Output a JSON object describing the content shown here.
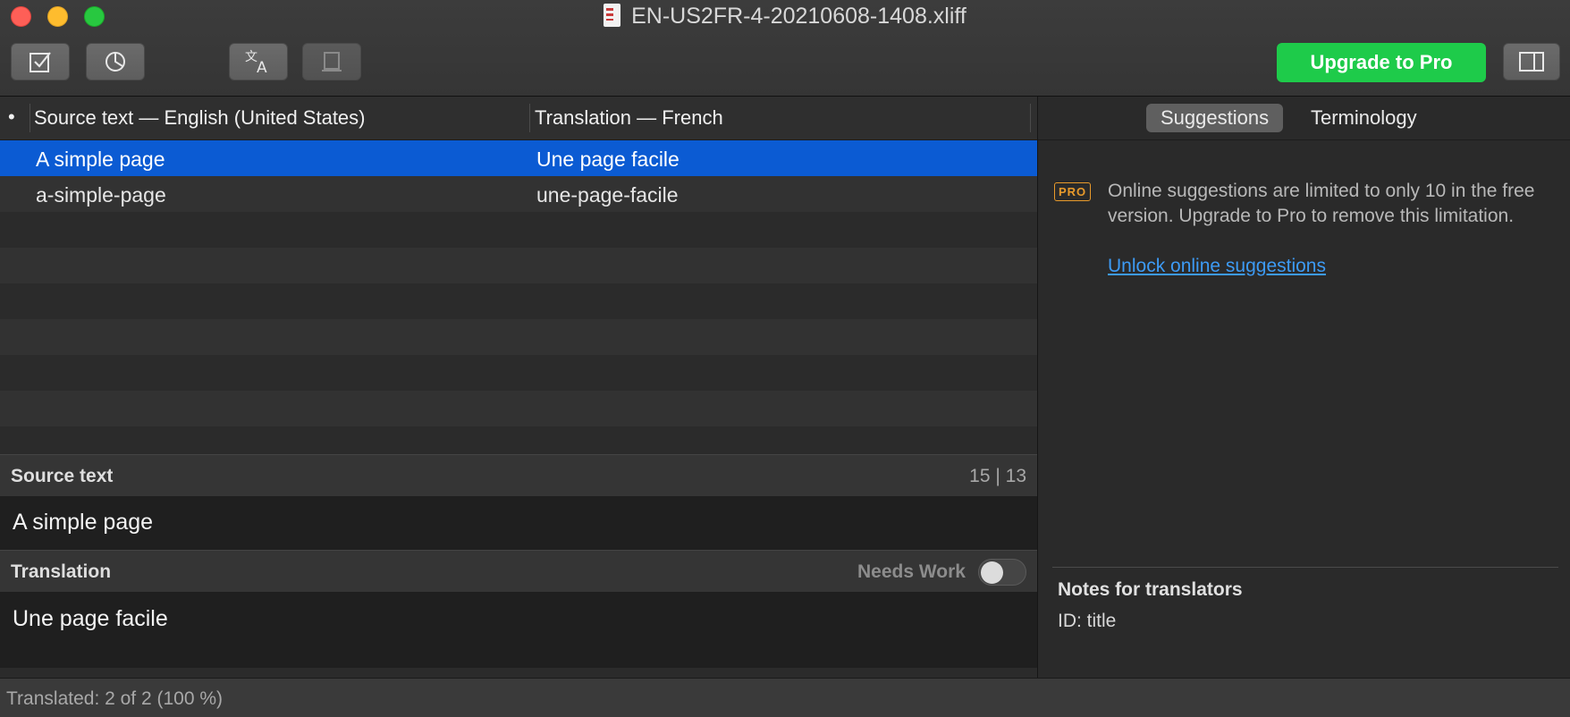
{
  "window": {
    "title": "EN-US2FR-4-20210608-1408.xliff"
  },
  "toolbar": {
    "upgrade_label": "Upgrade to Pro",
    "icons": [
      "checkbox-icon",
      "pie-chart-icon",
      "translate-icon",
      "document-icon",
      "sidebar-toggle-icon"
    ]
  },
  "table": {
    "bullet": "•",
    "headers": {
      "source": "Source text — English (United States)",
      "translation": "Translation — French"
    },
    "rows": [
      {
        "source": "A simple page",
        "translation": "Une page facile",
        "selected": true
      },
      {
        "source": "a-simple-page",
        "translation": "une-page-facile",
        "selected": false
      }
    ]
  },
  "source_section": {
    "label": "Source text",
    "count": "15 | 13",
    "text": "A simple page"
  },
  "translation_section": {
    "label": "Translation",
    "needs_work_label": "Needs Work",
    "needs_work_on": false,
    "text": "Une page facile"
  },
  "sidebar": {
    "tabs": [
      "Suggestions",
      "Terminology"
    ],
    "active_tab": "Suggestions",
    "pro_badge": "PRO",
    "message": "Online suggestions are limited to only 10 in the free version. Upgrade to Pro to remove this limitation.",
    "link": "Unlock online suggestions",
    "notes_title": "Notes for translators",
    "notes_id": "ID: title"
  },
  "status": {
    "text": "Translated: 2 of 2 (100 %)"
  },
  "colors": {
    "selection": "#0b5bd3",
    "upgrade": "#1ecb4a",
    "link": "#3d9bf5",
    "pro_badge": "#e89a2b"
  }
}
